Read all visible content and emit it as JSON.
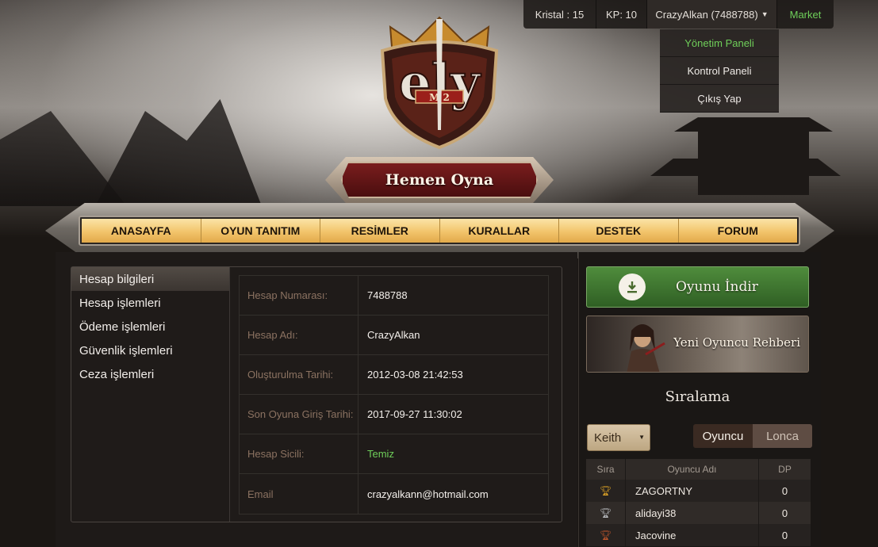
{
  "topbar": {
    "kristal": "Kristal : 15",
    "kp": "KP: 10",
    "user": "CrazyAlkan (7488788)",
    "market": "Market"
  },
  "user_menu": {
    "items": [
      {
        "label": "Yönetim Paneli",
        "active": true
      },
      {
        "label": "Kontrol Paneli",
        "active": false
      },
      {
        "label": "Çıkış Yap",
        "active": false
      }
    ]
  },
  "hero": {
    "play_label": "Hemen Oyna"
  },
  "nav": {
    "items": [
      "ANASAYFA",
      "OYUN TANITIM",
      "RESİMLER",
      "KURALLAR",
      "DESTEK",
      "FORUM"
    ]
  },
  "account_menu": {
    "items": [
      {
        "label": "Hesap bilgileri",
        "active": true
      },
      {
        "label": "Hesap işlemleri",
        "active": false
      },
      {
        "label": "Ödeme işlemleri",
        "active": false
      },
      {
        "label": "Güvenlik işlemleri",
        "active": false
      },
      {
        "label": "Ceza işlemleri",
        "active": false
      }
    ]
  },
  "account_info": {
    "rows": [
      {
        "label": "Hesap Numarası:",
        "value": "7488788"
      },
      {
        "label": "Hesap Adı:",
        "value": "CrazyAlkan"
      },
      {
        "label": "Oluşturulma Tarihi:",
        "value": "2012-03-08 21:42:53"
      },
      {
        "label": "Son Oyuna Giriş Tarihi:",
        "value": "2017-09-27 11:30:02"
      },
      {
        "label": "Hesap Sicili:",
        "value": "Temiz"
      },
      {
        "label": "Email",
        "value": "crazyalkann@hotmail.com"
      }
    ]
  },
  "sidebar": {
    "download_label": "Oyunu İndir",
    "guide_label": "Yeni Oyuncu Rehberi",
    "ranking_title": "Sıralama",
    "server_select": "Keith",
    "toggle": {
      "player": "Oyuncu",
      "guild": "Lonca"
    },
    "table_headers": {
      "rank": "Sıra",
      "name": "Oyuncu Adı",
      "dp": "DP"
    },
    "rows": [
      {
        "name": "ZAGORTNY",
        "dp": "0",
        "trophy": "gold"
      },
      {
        "name": "alidayi38",
        "dp": "0",
        "trophy": "silver"
      },
      {
        "name": "Jacovine",
        "dp": "0",
        "trophy": "bronze"
      }
    ]
  },
  "colors": {
    "green_accent": "#6fcf5a",
    "nav_gold": "#f2c46b",
    "play_red": "#7a1d1d",
    "trophy_gold": "#e0a526",
    "trophy_silver": "#bfc2c6",
    "trophy_bronze": "#c0562c"
  }
}
